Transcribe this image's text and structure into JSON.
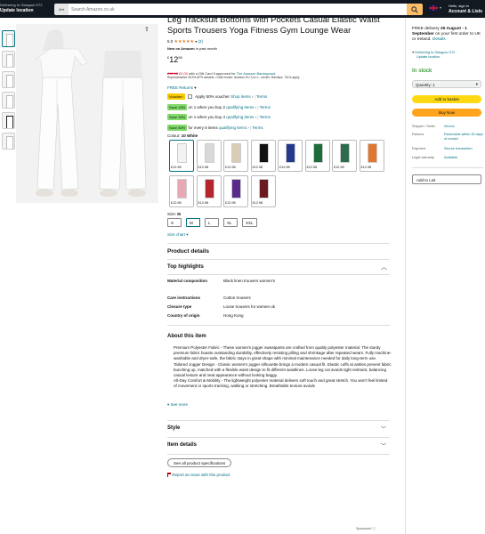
{
  "header": {
    "deliver_line1": "Delivering to Glasgow G72",
    "deliver_line2": "Update location",
    "search_category": "All",
    "search_placeholder": "Search Amazon.co.uk",
    "account_line1": "Hello, sign in",
    "account_line2": "Account & Lists"
  },
  "product": {
    "title": "Leg Tracksuit Bottoms with Pockets Casual Elastic Waist Sports Trousers Yoga Fitness Gym Lounge Wear",
    "rating": "5.0",
    "rating_count": "(2)",
    "new_on_amazon": "New on Amazon",
    "new_on_amazon_suffix": "in past month",
    "price_whole": "12",
    "price_fraction": "98",
    "price_currency": "£",
    "gift_card_old": "£12.98",
    "gift_card_new": "£0.00",
    "gift_card_text": "with a Gift Card if approved for",
    "gift_card_link": "The Amazon Barclaycard",
    "apr_text": "Representative 28.9% APR variable. Credit broker: Amazon EU S.à.r.L. Lender: Barclays. T&Cs apply.",
    "free_returns": "FREE Returns",
    "voucher_badge": "Voucher:",
    "voucher_text": "Apply 50% voucher",
    "shop_items": "Shop items",
    "terms": "Terms",
    "promos": [
      {
        "badge": "Save 15%",
        "text": "on 1 when you buy 2",
        "link": "qualifying items"
      },
      {
        "badge": "Save 35%",
        "text": "on 1 when you buy 4",
        "link": "qualifying items"
      },
      {
        "badge": "Save 50%",
        "text": "for every 6 items",
        "link": "qualifying items"
      }
    ],
    "colour_label": "Colour:",
    "colour_value": "10 White",
    "swatches": [
      {
        "price": "£12.98",
        "color": "#f2f2f2"
      },
      {
        "price": "£12.98",
        "color": "#d8d8d8"
      },
      {
        "price": "£12.98",
        "color": "#d9cdb8"
      },
      {
        "price": "£12.98",
        "color": "#111111"
      },
      {
        "price": "£12.98",
        "color": "#233a8c"
      },
      {
        "price": "£12.98",
        "color": "#1f6b3a"
      },
      {
        "price": "£12.98",
        "color": "#2d6b4a"
      },
      {
        "price": "£12.98",
        "color": "#e0762f"
      },
      {
        "price": "£12.98",
        "color": "#e8a8b4"
      },
      {
        "price": "£12.98",
        "color": "#b5252d"
      },
      {
        "price": "£12.98",
        "color": "#5a2a8a"
      },
      {
        "price": "£12.98",
        "color": "#6b1a1f"
      }
    ],
    "size_label": "Size:",
    "size_value": "M",
    "sizes": [
      "S",
      "M",
      "L",
      "XL",
      "XXL"
    ],
    "size_chart": "Size chart"
  },
  "details": {
    "product_details": "Product details",
    "top_highlights": "Top highlights",
    "attributes": [
      {
        "k": "Material composition",
        "v": "Black linen trousers women's"
      },
      {
        "k": "Care instructions",
        "v": "Cotton trousers"
      },
      {
        "k": "Closure type",
        "v": "Loose trousers for women uk"
      },
      {
        "k": "Country of origin",
        "v": "Hong Kong"
      }
    ],
    "about_title": "About this item",
    "bullets": [
      "Premium Polyester Fabric - These women's jogger sweatpants are crafted from quality polyester material. The sturdy premium fabric boasts outstanding durability, effectively resisting pilling and shrinkage after repeated wears. Fully machine-washable and dryer-safe, the fabric stays in great shape with minimal maintenance needed for daily long-term use.",
      "Tailored Jogger Design - Classic women's jogger silhouette brings a modern casual fit. Elastic cuffs at ankles prevent fabric bunching up, matched with a flexible waist design to fit different waistlines. Loose leg cut avoids tight restraint, balancing casual leisure and neat appearance without looking baggy.",
      "All-Day Comfort & Mobility - The lightweight polyester material delivers soft touch and great stretch. You won't feel limited of movement or sports tracking, walking or stretching. Breathable texture avoids"
    ],
    "see_more": "See more",
    "style": "Style",
    "item_details": "Item details",
    "see_all_specs": "See all product specifications",
    "report_issue": "Report an issue with this product",
    "sponsored": "Sponsored"
  },
  "buybox": {
    "delivery_prefix": "FREE delivery",
    "delivery_date": "25 August - 1 September",
    "delivery_suffix": "on your first order to UK or Ireland.",
    "details_link": "Details",
    "location_line1": "Delivering to Glasgow G72 -",
    "location_line2": "Update location",
    "stock": "In stock",
    "quantity": "Quantity: 1",
    "add_to_basket": "Add to basket",
    "buy_now": "Buy Now",
    "info": [
      {
        "k": "Shipper / Seller",
        "v": "Xinnnx"
      },
      {
        "k": "Returns",
        "v": "Returnable within 30 days of receipt"
      },
      {
        "k": "Payment",
        "v": "Secure transaction"
      },
      {
        "k": "Legal warranty",
        "v": "Available"
      }
    ],
    "add_to_list": "Add to List"
  },
  "colors": {
    "header_bg": "#131921",
    "search_button": "#febd69",
    "add_to_basket": "#ffd814",
    "buy_now": "#ffa41c",
    "in_stock": "#007600",
    "price_strike": "#cc0c39",
    "link": "#007185"
  }
}
